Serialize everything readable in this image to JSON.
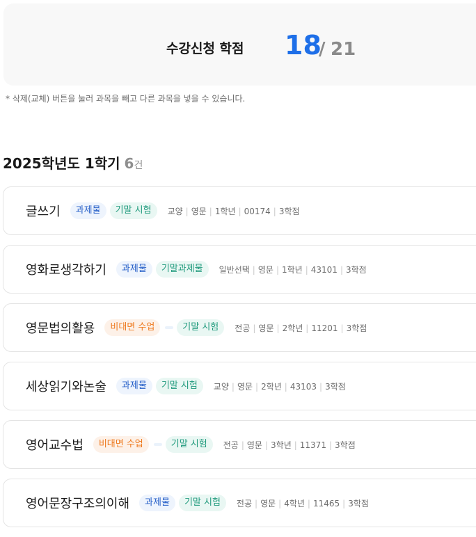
{
  "summary": {
    "label": "수강신청 학점",
    "current": "18",
    "separator": "/",
    "max": "21"
  },
  "notice": "* 삭제(교체) 버튼을 눌러 과목을 빼고 다른 과목을 넣을 수 있습니다.",
  "semester": {
    "title": "2025학년도 1학기",
    "count": "6",
    "count_unit": "건"
  },
  "colors": {
    "accent": "#1e6fe8",
    "tag_assign": "#2a62c9",
    "tag_exam": "#1f9a7c",
    "tag_online": "#ee7a1f"
  },
  "courses": [
    {
      "name": "글쓰기",
      "tags": [
        "과제물",
        "기말 시험"
      ],
      "meta": [
        "교양",
        "영문",
        "1학년",
        "00174",
        "3학점"
      ]
    },
    {
      "name": "영화로생각하기",
      "tags": [
        "과제물",
        "기말과제물"
      ],
      "meta": [
        "일반선택",
        "영문",
        "1학년",
        "43101",
        "3학점"
      ]
    },
    {
      "name": "영문법의활용",
      "tags": [
        "비대면 수업",
        "기말 시험"
      ],
      "meta": [
        "전공",
        "영문",
        "2학년",
        "11201",
        "3학점"
      ]
    },
    {
      "name": "세상읽기와논술",
      "tags": [
        "과제물",
        "기말 시험"
      ],
      "meta": [
        "교양",
        "영문",
        "2학년",
        "43103",
        "3학점"
      ]
    },
    {
      "name": "영어교수법",
      "tags": [
        "비대면 수업",
        "기말 시험"
      ],
      "meta": [
        "전공",
        "영문",
        "3학년",
        "11371",
        "3학점"
      ]
    },
    {
      "name": "영어문장구조의이해",
      "tags": [
        "과제물",
        "기말 시험"
      ],
      "meta": [
        "전공",
        "영문",
        "4학년",
        "11465",
        "3학점"
      ]
    }
  ]
}
